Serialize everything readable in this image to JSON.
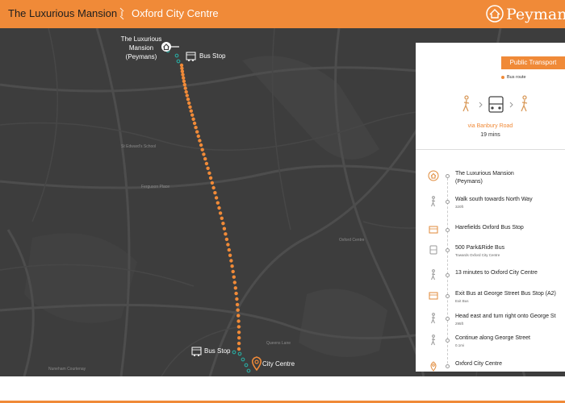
{
  "header": {
    "origin": "The Luxurious Mansion",
    "destination": "Oxford City Centre",
    "brand": "Peymans",
    "logo_icon": "house-icon"
  },
  "map": {
    "mansion_label_line1": "The Luxurious",
    "mansion_label_line2": "Mansion",
    "mansion_label_line3": "(Peymans)",
    "bus_stop_top": "Bus Stop",
    "bus_stop_bottom": "Bus Stop",
    "city_centre": "City Centre",
    "route_color": "#f08a38",
    "walk_color": "#2aa198",
    "place_labels": [
      "St Edward's School",
      "Ferguson Place",
      "Oxford Centre",
      "Nuneham Courtenay",
      "Queens Lane"
    ]
  },
  "panel": {
    "mode_button": "Public Transport",
    "legend_bus_route": "Bus route",
    "via": "via Banbury Road",
    "duration": "19 mins",
    "steps": [
      {
        "icon": "house-icon",
        "title": "The Luxurious Mansion",
        "title2": "(Peymans)",
        "sub": ""
      },
      {
        "icon": "walk-icon",
        "title": "Walk south towards North Way",
        "title2": "",
        "sub": "320ft"
      },
      {
        "icon": "bus-stop-icon",
        "title": "Harefields Oxford Bus Stop",
        "title2": "",
        "sub": ""
      },
      {
        "icon": "bus-icon",
        "title": "500 Park&Ride Bus",
        "title2": "",
        "sub": "Towards Oxford City Centre"
      },
      {
        "icon": "walk-icon",
        "title": "13 minutes to Oxford City Centre",
        "title2": "",
        "sub": ""
      },
      {
        "icon": "bus-stop-icon",
        "title": "Exit Bus at George Street Bus Stop (A2)",
        "title2": "",
        "sub": "Exit Bus"
      },
      {
        "icon": "walk-icon",
        "title": "Head east and turn right onto George St",
        "title2": "",
        "sub": "295ft"
      },
      {
        "icon": "walk-icon",
        "title": "Continue along George Street",
        "title2": "",
        "sub": "0.1mi"
      },
      {
        "icon": "pin-icon",
        "title": "Oxford City Centre",
        "title2": "",
        "sub": ""
      }
    ]
  },
  "colors": {
    "accent": "#f08a38",
    "map_bg": "#3d3d3d",
    "walk_dots": "#2aa198"
  }
}
